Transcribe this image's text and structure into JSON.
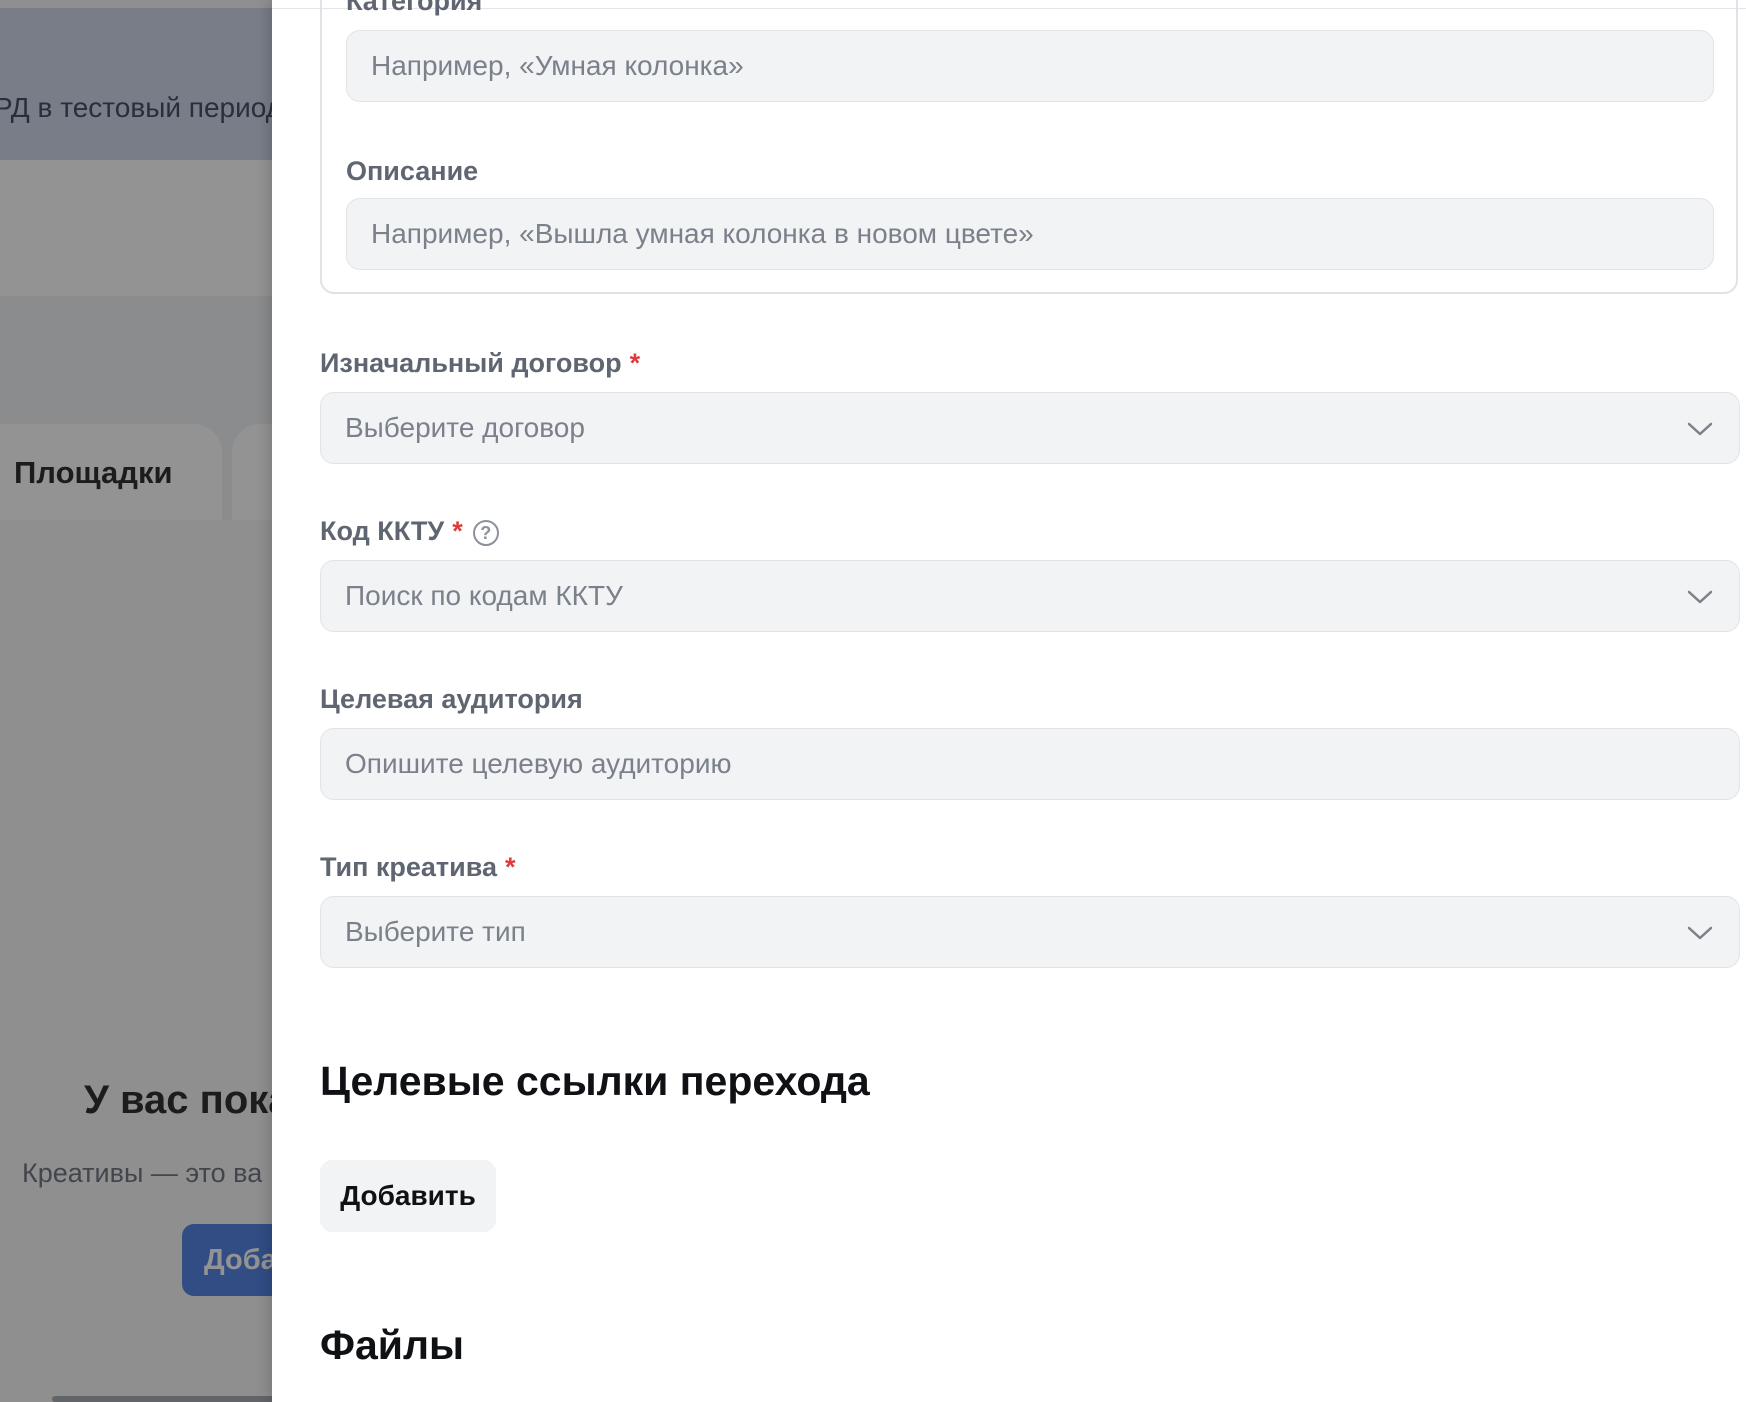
{
  "background": {
    "banner_text": "РД в тестовый период",
    "tab_label": "Площадки",
    "empty_title": "У вас пока",
    "empty_subtitle": "Креативы — это ва",
    "add_button_label": "Доба"
  },
  "drawer": {
    "category": {
      "label": "Категория",
      "placeholder": "Например, «Умная колонка»"
    },
    "description": {
      "label": "Описание",
      "placeholder": "Например, «Вышла умная колонка в новом цвете»"
    },
    "contract": {
      "label": "Изначальный договор",
      "required_mark": "*",
      "placeholder": "Выберите договор"
    },
    "kktu": {
      "label": "Код ККТУ",
      "required_mark": "*",
      "help_icon": "?",
      "placeholder": "Поиск по кодам ККТУ"
    },
    "audience": {
      "label": "Целевая аудитория",
      "placeholder": "Опишите целевую аудиторию"
    },
    "creative_type": {
      "label": "Тип креатива",
      "required_mark": "*",
      "placeholder": "Выберите тип"
    },
    "links_section": {
      "title": "Целевые ссылки перехода",
      "add_button": "Добавить"
    },
    "files_section": {
      "title": "Файлы"
    }
  },
  "colors": {
    "required": "#e03b3b",
    "input_bg": "#f2f3f5",
    "overlay": "rgba(40,40,40,0.5)",
    "primary_button": "#3b73e0"
  },
  "icons": {
    "chevron": "chevron-down-icon",
    "help": "help-circle-icon"
  }
}
